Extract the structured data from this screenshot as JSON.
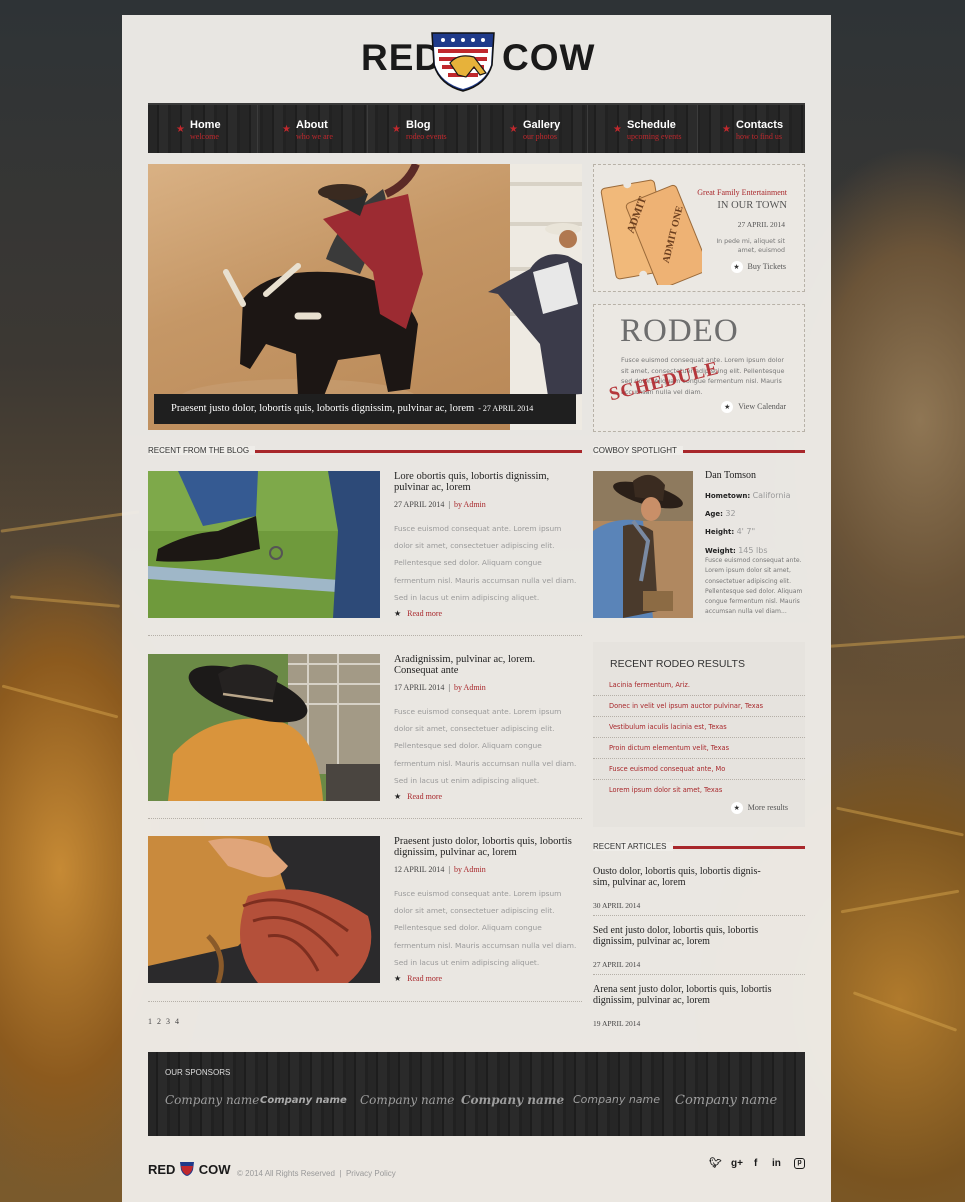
{
  "logo": {
    "word_left": "RED",
    "word_right": "COW"
  },
  "nav": [
    {
      "label": "Home",
      "sub": "welcome"
    },
    {
      "label": "About",
      "sub": "who we are"
    },
    {
      "label": "Blog",
      "sub": "rodeo events"
    },
    {
      "label": "Gallery",
      "sub": "our photos"
    },
    {
      "label": "Schedule",
      "sub": "upcoming events"
    },
    {
      "label": "Contacts",
      "sub": "how to find us"
    }
  ],
  "slider": {
    "caption": "Praesent justo dolor, lobortis quis, lobortis dignissim, pulvinar ac, lorem",
    "date": "- 27 APRIL 2014"
  },
  "tickets_box": {
    "ticket1": "ADMIT",
    "ticket2": "ADMIT ONE",
    "tagline": "Great Family Entertainment",
    "heading": "IN OUR TOWN",
    "date": "27 APRIL 2014",
    "text": "In pede mi, aliquet sit amet, euismod",
    "button": "Buy Tickets"
  },
  "rodeo_box": {
    "title": "RODEO",
    "stamp": "SCHEDULE",
    "text": "Fusce euismod consequat ante. Lorem ipsum dolor sit amet, consectetuer adipiscing elit. Pellentesque sed dolor. Aliquam congue fermentum nisl. Mauris accumsan nulla vel diam.",
    "button": "View Calendar"
  },
  "blog": {
    "heading": "RECENT FROM THE BLOG",
    "by_prefix": "by",
    "read_more": "Read more",
    "pagination": [
      "1",
      "2",
      "3",
      "4"
    ],
    "body": "Fusce euismod consequat ante. Lorem ipsum dolor sit amet, consectetuer adipiscing elit. Pellentesque sed dolor. Aliquam congue fermentum nisl. Mauris accumsan nulla vel diam. Sed in lacus ut enim adipiscing aliquet.",
    "posts": [
      {
        "title": "Lore obortis quis, lobortis dignissim, pulvinar ac, lorem",
        "date": "27 APRIL 2014",
        "author": "Admin"
      },
      {
        "title": "Aradignissim, pulvinar ac, lorem. Consequat ante",
        "date": "17 APRIL 2014",
        "author": "Admin"
      },
      {
        "title": "Praesent justo dolor, lobortis quis, lobortis dignissim, pulvinar ac, lorem",
        "date": "12 APRIL 2014",
        "author": "Admin"
      }
    ]
  },
  "spotlight": {
    "heading": "COWBOY SPOTLIGHT",
    "name": "Dan Tomson",
    "fields": [
      {
        "k": "Hometown:",
        "v": "California"
      },
      {
        "k": "Age:",
        "v": "32"
      },
      {
        "k": "Height:",
        "v": "4' 7\""
      },
      {
        "k": "Weight:",
        "v": "145 lbs"
      }
    ],
    "text": "Fusce euismod consequat ante. Lorem ipsum dolor sit amet, consectetuer adipiscing elit. Pellentesque sed dolor. Aliquam congue fermentum nisl. Mauris accumsan nulla vel diam..."
  },
  "results": {
    "heading": "RECENT RODEO RESULTS",
    "items": [
      "Lacinia fermentum, Ariz.",
      "Donec in velit vel ipsum auctor pulvinar, Texas",
      "Vestibulum iaculis lacinia est, Texas",
      "Proin dictum elementum velit, Texas",
      "Fusce euismod consequat ante, Mo",
      "Lorem ipsum dolor sit amet, Texas"
    ],
    "button": "More results"
  },
  "articles": {
    "heading": "RECENT ARTICLES",
    "items": [
      {
        "title": "Ousto dolor, lobortis quis, lobortis dignis-sim, pulvinar ac, lorem",
        "date": "30 APRIL 2014"
      },
      {
        "title": "Sed ent justo dolor, lobortis quis, lobortis dignissim, pulvinar ac, lorem",
        "date": "27 APRIL 2014"
      },
      {
        "title": "Arena sent justo dolor, lobortis quis, lobortis dignissim, pulvinar ac, lorem",
        "date": "19 APRIL 2014"
      }
    ]
  },
  "sponsors": {
    "heading": "OUR SPONSORS",
    "names": [
      "Company name",
      "Company name",
      "Company name",
      "Company name",
      "Company name",
      "Company name"
    ]
  },
  "footer": {
    "copyright": "© 2014 All Rights Reserved",
    "separator": "|",
    "privacy": "Privacy Policy",
    "social": [
      "twitter-icon",
      "google-plus-icon",
      "facebook-icon",
      "linkedin-icon",
      "pinterest-icon"
    ]
  },
  "colors": {
    "accent": "#a8272b",
    "nav_bg": "#262626",
    "page_bg": "#efede9"
  }
}
